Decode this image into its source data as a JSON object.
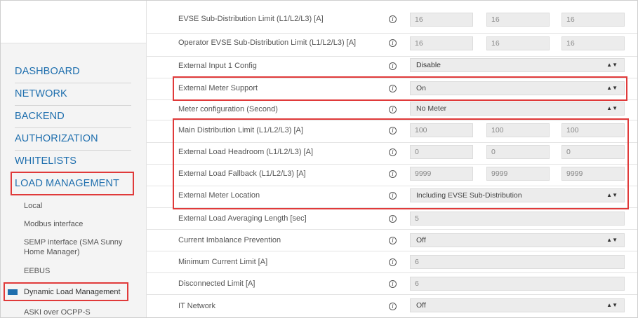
{
  "sidebar": {
    "main_items": [
      "DASHBOARD",
      "NETWORK",
      "BACKEND",
      "AUTHORIZATION",
      "WHITELISTS",
      "LOAD MANAGEMENT"
    ],
    "sub_items": [
      "Local",
      "Modbus interface",
      "SEMP interface (SMA Sunny Home Manager)",
      "EEBUS",
      "Dynamic Load Management",
      "ASKI over OCPP-S"
    ],
    "active_sub_item": "Dynamic Load Management",
    "accent_color": "#1f6fae"
  },
  "annotation_color": "#e03a3a",
  "info_icon_glyph": "i",
  "select_arrow_glyph": "▲▼",
  "form": {
    "rows": [
      {
        "label": "EVSE Sub-Distribution Limit (L1/L2/L3) [A]",
        "kind": "triple",
        "values": [
          "16",
          "16",
          "16"
        ]
      },
      {
        "label": "Operator EVSE Sub-Distribution Limit (L1/L2/L3) [A]",
        "kind": "triple",
        "values": [
          "16",
          "16",
          "16"
        ]
      },
      {
        "label": "External Input 1 Config",
        "kind": "select",
        "value": "Disable"
      },
      {
        "label": "External Meter Support",
        "kind": "select",
        "value": "On"
      },
      {
        "label": "Meter configuration (Second)",
        "kind": "select",
        "value": "No Meter"
      },
      {
        "label": "Main Distribution Limit (L1/L2/L3) [A]",
        "kind": "triple",
        "values": [
          "100",
          "100",
          "100"
        ]
      },
      {
        "label": "External Load Headroom (L1/L2/L3) [A]",
        "kind": "triple",
        "values": [
          "0",
          "0",
          "0"
        ]
      },
      {
        "label": "External Load Fallback (L1/L2/L3) [A]",
        "kind": "triple",
        "values": [
          "9999",
          "9999",
          "9999"
        ]
      },
      {
        "label": "External Meter Location",
        "kind": "select",
        "value": "Including EVSE Sub-Distribution"
      },
      {
        "label": "External Load Averaging Length [sec]",
        "kind": "single",
        "value": "5"
      },
      {
        "label": "Current Imbalance Prevention",
        "kind": "select",
        "value": "Off"
      },
      {
        "label": "Minimum Current Limit [A]",
        "kind": "single",
        "value": "6"
      },
      {
        "label": "Disconnected Limit [A]",
        "kind": "single",
        "value": "6"
      },
      {
        "label": "IT Network",
        "kind": "select",
        "value": "Off"
      }
    ]
  }
}
